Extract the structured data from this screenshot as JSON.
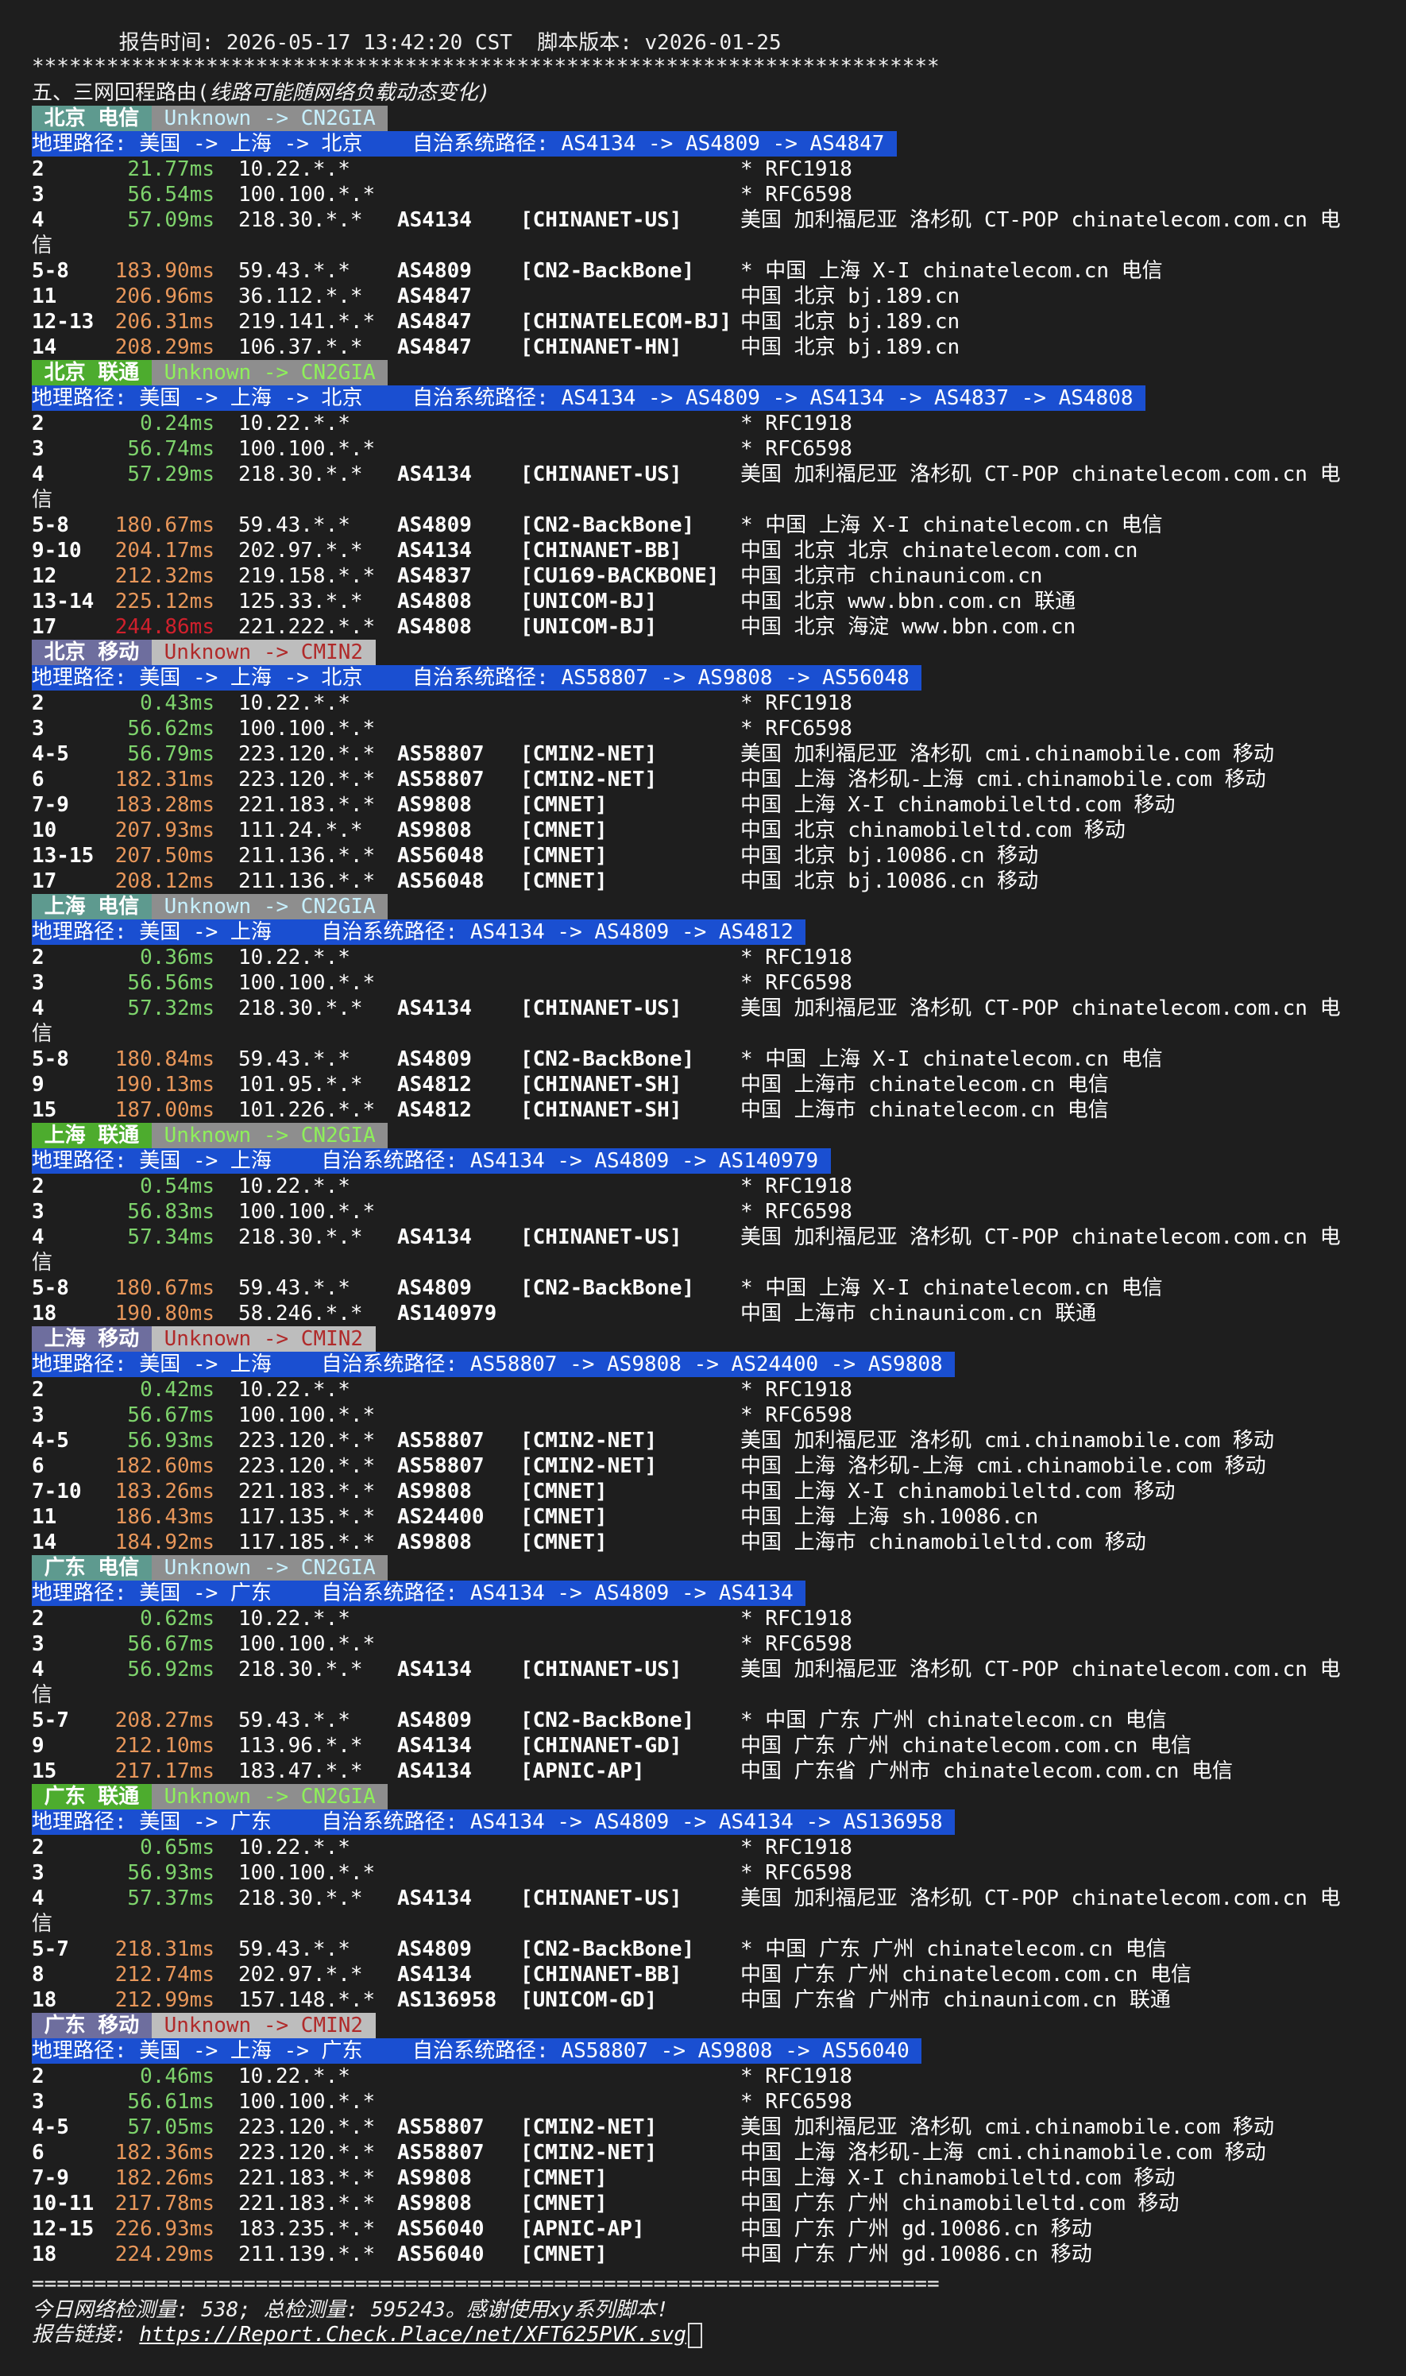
{
  "header": {
    "time_line": "       报告时间: 2026-05-17 13:42:20 CST  脚本版本: v2026-01-25",
    "stars": "*************************************************************************",
    "section_title": "五、三网回程路由(",
    "section_note": "线路可能随网络负载动态变化)"
  },
  "colors": {
    "telecom_tag_bg": "#5e9a8f",
    "unicom_tag_bg": "#4dac2e",
    "mobile_tag_bg": "#6e6e9e",
    "cn2gia_tag_bg": "#8e8e8e",
    "cmin2_tag_bg": "#bdbdbd",
    "geo_bar_bg": "#1a4fd1",
    "latency_green": "#7ed36c",
    "latency_orange": "#e8975a",
    "latency_red": "#d0202c"
  },
  "blocks": [
    {
      "tag": " 北京 电信 ",
      "tag_type": "telecom",
      "route": " Unknown -> CN2GIA ",
      "route_type": "cn2gia",
      "geo": "地理路径: 美国 -> 上海 -> 北京    自治系统路径: AS4134 -> AS4809 -> AS4847 ",
      "hops": [
        {
          "hop": "2",
          "lat": "21.77ms",
          "c": "green",
          "ip": "10.22.*.*",
          "asn": "",
          "net": "",
          "loc": "* RFC1918"
        },
        {
          "hop": "3",
          "lat": "56.54ms",
          "c": "green",
          "ip": "100.100.*.*",
          "asn": "",
          "net": "",
          "loc": "* RFC6598"
        },
        {
          "hop": "4",
          "lat": "57.09ms",
          "c": "green",
          "ip": "218.30.*.*",
          "asn": "AS4134",
          "net": "[CHINANET-US]",
          "loc": "美国 加利福尼亚 洛杉矶 CT-POP chinatelecom.com.cn 电",
          "wrap": "信"
        },
        {
          "hop": "5-8",
          "lat": "183.90ms",
          "c": "orange",
          "ip": "59.43.*.*",
          "asn": "AS4809",
          "net": "[CN2-BackBone]",
          "loc": "* 中国 上海 X-I chinatelecom.cn 电信"
        },
        {
          "hop": "11",
          "lat": "206.96ms",
          "c": "orange",
          "ip": "36.112.*.*",
          "asn": "AS4847",
          "net": "",
          "loc": "中国 北京 bj.189.cn"
        },
        {
          "hop": "12-13",
          "lat": "206.31ms",
          "c": "orange",
          "ip": "219.141.*.*",
          "asn": "AS4847",
          "net": "[CHINATELECOM-BJ]",
          "loc": "中国 北京 bj.189.cn"
        },
        {
          "hop": "14",
          "lat": "208.29ms",
          "c": "orange",
          "ip": "106.37.*.*",
          "asn": "AS4847",
          "net": "[CHINANET-HN]",
          "loc": "中国 北京 bj.189.cn"
        }
      ]
    },
    {
      "tag": " 北京 联通 ",
      "tag_type": "unicom",
      "route": " Unknown -> CN2GIA ",
      "route_type": "cn2gia_green",
      "geo": "地理路径: 美国 -> 上海 -> 北京    自治系统路径: AS4134 -> AS4809 -> AS4134 -> AS4837 -> AS4808 ",
      "hops": [
        {
          "hop": "2",
          "lat": "0.24ms",
          "c": "green",
          "ip": "10.22.*.*",
          "asn": "",
          "net": "",
          "loc": "* RFC1918"
        },
        {
          "hop": "3",
          "lat": "56.74ms",
          "c": "green",
          "ip": "100.100.*.*",
          "asn": "",
          "net": "",
          "loc": "* RFC6598"
        },
        {
          "hop": "4",
          "lat": "57.29ms",
          "c": "green",
          "ip": "218.30.*.*",
          "asn": "AS4134",
          "net": "[CHINANET-US]",
          "loc": "美国 加利福尼亚 洛杉矶 CT-POP chinatelecom.com.cn 电",
          "wrap": "信"
        },
        {
          "hop": "5-8",
          "lat": "180.67ms",
          "c": "orange",
          "ip": "59.43.*.*",
          "asn": "AS4809",
          "net": "[CN2-BackBone]",
          "loc": "* 中国 上海 X-I chinatelecom.cn 电信"
        },
        {
          "hop": "9-10",
          "lat": "204.17ms",
          "c": "orange",
          "ip": "202.97.*.*",
          "asn": "AS4134",
          "net": "[CHINANET-BB]",
          "loc": "中国 北京 北京 chinatelecom.com.cn"
        },
        {
          "hop": "12",
          "lat": "212.32ms",
          "c": "orange",
          "ip": "219.158.*.*",
          "asn": "AS4837",
          "net": "[CU169-BACKBONE]",
          "loc": "中国 北京市 chinaunicom.cn"
        },
        {
          "hop": "13-14",
          "lat": "225.12ms",
          "c": "orange",
          "ip": "125.33.*.*",
          "asn": "AS4808",
          "net": "[UNICOM-BJ]",
          "loc": "中国 北京 www.bbn.com.cn 联通"
        },
        {
          "hop": "17",
          "lat": "244.86ms",
          "c": "red",
          "ip": "221.222.*.*",
          "asn": "AS4808",
          "net": "[UNICOM-BJ]",
          "loc": "中国 北京 海淀 www.bbn.com.cn"
        }
      ]
    },
    {
      "tag": " 北京 移动 ",
      "tag_type": "mobile",
      "route": " Unknown -> CMIN2 ",
      "route_type": "cmin2",
      "geo": "地理路径: 美国 -> 上海 -> 北京    自治系统路径: AS58807 -> AS9808 -> AS56048 ",
      "hops": [
        {
          "hop": "2",
          "lat": "0.43ms",
          "c": "green",
          "ip": "10.22.*.*",
          "asn": "",
          "net": "",
          "loc": "* RFC1918"
        },
        {
          "hop": "3",
          "lat": "56.62ms",
          "c": "green",
          "ip": "100.100.*.*",
          "asn": "",
          "net": "",
          "loc": "* RFC6598"
        },
        {
          "hop": "4-5",
          "lat": "56.79ms",
          "c": "green",
          "ip": "223.120.*.*",
          "asn": "AS58807",
          "net": "[CMIN2-NET]",
          "loc": "美国 加利福尼亚 洛杉矶 cmi.chinamobile.com 移动"
        },
        {
          "hop": "6",
          "lat": "182.31ms",
          "c": "orange",
          "ip": "223.120.*.*",
          "asn": "AS58807",
          "net": "[CMIN2-NET]",
          "loc": "中国 上海 洛杉矶-上海 cmi.chinamobile.com 移动"
        },
        {
          "hop": "7-9",
          "lat": "183.28ms",
          "c": "orange",
          "ip": "221.183.*.*",
          "asn": "AS9808",
          "net": "[CMNET]",
          "loc": "中国 上海 X-I chinamobileltd.com 移动"
        },
        {
          "hop": "10",
          "lat": "207.93ms",
          "c": "orange",
          "ip": "111.24.*.*",
          "asn": "AS9808",
          "net": "[CMNET]",
          "loc": "中国 北京 chinamobileltd.com 移动"
        },
        {
          "hop": "13-15",
          "lat": "207.50ms",
          "c": "orange",
          "ip": "211.136.*.*",
          "asn": "AS56048",
          "net": "[CMNET]",
          "loc": "中国 北京 bj.10086.cn 移动"
        },
        {
          "hop": "17",
          "lat": "208.12ms",
          "c": "orange",
          "ip": "211.136.*.*",
          "asn": "AS56048",
          "net": "[CMNET]",
          "loc": "中国 北京 bj.10086.cn 移动"
        }
      ]
    },
    {
      "tag": " 上海 电信 ",
      "tag_type": "telecom",
      "route": " Unknown -> CN2GIA ",
      "route_type": "cn2gia",
      "geo": "地理路径: 美国 -> 上海    自治系统路径: AS4134 -> AS4809 -> AS4812 ",
      "hops": [
        {
          "hop": "2",
          "lat": "0.36ms",
          "c": "green",
          "ip": "10.22.*.*",
          "asn": "",
          "net": "",
          "loc": "* RFC1918"
        },
        {
          "hop": "3",
          "lat": "56.56ms",
          "c": "green",
          "ip": "100.100.*.*",
          "asn": "",
          "net": "",
          "loc": "* RFC6598"
        },
        {
          "hop": "4",
          "lat": "57.32ms",
          "c": "green",
          "ip": "218.30.*.*",
          "asn": "AS4134",
          "net": "[CHINANET-US]",
          "loc": "美国 加利福尼亚 洛杉矶 CT-POP chinatelecom.com.cn 电",
          "wrap": "信"
        },
        {
          "hop": "5-8",
          "lat": "180.84ms",
          "c": "orange",
          "ip": "59.43.*.*",
          "asn": "AS4809",
          "net": "[CN2-BackBone]",
          "loc": "* 中国 上海 X-I chinatelecom.cn 电信"
        },
        {
          "hop": "9",
          "lat": "190.13ms",
          "c": "orange",
          "ip": "101.95.*.*",
          "asn": "AS4812",
          "net": "[CHINANET-SH]",
          "loc": "中国 上海市 chinatelecom.cn 电信"
        },
        {
          "hop": "15",
          "lat": "187.00ms",
          "c": "orange",
          "ip": "101.226.*.*",
          "asn": "AS4812",
          "net": "[CHINANET-SH]",
          "loc": "中国 上海市 chinatelecom.cn 电信"
        }
      ]
    },
    {
      "tag": " 上海 联通 ",
      "tag_type": "unicom",
      "route": " Unknown -> CN2GIA ",
      "route_type": "cn2gia_green",
      "geo": "地理路径: 美国 -> 上海    自治系统路径: AS4134 -> AS4809 -> AS140979 ",
      "hops": [
        {
          "hop": "2",
          "lat": "0.54ms",
          "c": "green",
          "ip": "10.22.*.*",
          "asn": "",
          "net": "",
          "loc": "* RFC1918"
        },
        {
          "hop": "3",
          "lat": "56.83ms",
          "c": "green",
          "ip": "100.100.*.*",
          "asn": "",
          "net": "",
          "loc": "* RFC6598"
        },
        {
          "hop": "4",
          "lat": "57.34ms",
          "c": "green",
          "ip": "218.30.*.*",
          "asn": "AS4134",
          "net": "[CHINANET-US]",
          "loc": "美国 加利福尼亚 洛杉矶 CT-POP chinatelecom.com.cn 电",
          "wrap": "信"
        },
        {
          "hop": "5-8",
          "lat": "180.67ms",
          "c": "orange",
          "ip": "59.43.*.*",
          "asn": "AS4809",
          "net": "[CN2-BackBone]",
          "loc": "* 中国 上海 X-I chinatelecom.cn 电信"
        },
        {
          "hop": "18",
          "lat": "190.80ms",
          "c": "orange",
          "ip": "58.246.*.*",
          "asn": "AS140979",
          "net": "",
          "loc": "中国 上海市 chinaunicom.cn 联通"
        }
      ]
    },
    {
      "tag": " 上海 移动 ",
      "tag_type": "mobile",
      "route": " Unknown -> CMIN2 ",
      "route_type": "cmin2",
      "geo": "地理路径: 美国 -> 上海    自治系统路径: AS58807 -> AS9808 -> AS24400 -> AS9808 ",
      "hops": [
        {
          "hop": "2",
          "lat": "0.42ms",
          "c": "green",
          "ip": "10.22.*.*",
          "asn": "",
          "net": "",
          "loc": "* RFC1918"
        },
        {
          "hop": "3",
          "lat": "56.67ms",
          "c": "green",
          "ip": "100.100.*.*",
          "asn": "",
          "net": "",
          "loc": "* RFC6598"
        },
        {
          "hop": "4-5",
          "lat": "56.93ms",
          "c": "green",
          "ip": "223.120.*.*",
          "asn": "AS58807",
          "net": "[CMIN2-NET]",
          "loc": "美国 加利福尼亚 洛杉矶 cmi.chinamobile.com 移动"
        },
        {
          "hop": "6",
          "lat": "182.60ms",
          "c": "orange",
          "ip": "223.120.*.*",
          "asn": "AS58807",
          "net": "[CMIN2-NET]",
          "loc": "中国 上海 洛杉矶-上海 cmi.chinamobile.com 移动"
        },
        {
          "hop": "7-10",
          "lat": "183.26ms",
          "c": "orange",
          "ip": "221.183.*.*",
          "asn": "AS9808",
          "net": "[CMNET]",
          "loc": "中国 上海 X-I chinamobileltd.com 移动"
        },
        {
          "hop": "11",
          "lat": "186.43ms",
          "c": "orange",
          "ip": "117.135.*.*",
          "asn": "AS24400",
          "net": "[CMNET]",
          "loc": "中国 上海 上海 sh.10086.cn"
        },
        {
          "hop": "14",
          "lat": "184.92ms",
          "c": "orange",
          "ip": "117.185.*.*",
          "asn": "AS9808",
          "net": "[CMNET]",
          "loc": "中国 上海市 chinamobileltd.com 移动"
        }
      ]
    },
    {
      "tag": " 广东 电信 ",
      "tag_type": "telecom",
      "route": " Unknown -> CN2GIA ",
      "route_type": "cn2gia",
      "geo": "地理路径: 美国 -> 广东    自治系统路径: AS4134 -> AS4809 -> AS4134 ",
      "hops": [
        {
          "hop": "2",
          "lat": "0.62ms",
          "c": "green",
          "ip": "10.22.*.*",
          "asn": "",
          "net": "",
          "loc": "* RFC1918"
        },
        {
          "hop": "3",
          "lat": "56.67ms",
          "c": "green",
          "ip": "100.100.*.*",
          "asn": "",
          "net": "",
          "loc": "* RFC6598"
        },
        {
          "hop": "4",
          "lat": "56.92ms",
          "c": "green",
          "ip": "218.30.*.*",
          "asn": "AS4134",
          "net": "[CHINANET-US]",
          "loc": "美国 加利福尼亚 洛杉矶 CT-POP chinatelecom.com.cn 电",
          "wrap": "信"
        },
        {
          "hop": "5-7",
          "lat": "208.27ms",
          "c": "orange",
          "ip": "59.43.*.*",
          "asn": "AS4809",
          "net": "[CN2-BackBone]",
          "loc": "* 中国 广东 广州 chinatelecom.cn 电信"
        },
        {
          "hop": "9",
          "lat": "212.10ms",
          "c": "orange",
          "ip": "113.96.*.*",
          "asn": "AS4134",
          "net": "[CHINANET-GD]",
          "loc": "中国 广东 广州 chinatelecom.com.cn 电信"
        },
        {
          "hop": "15",
          "lat": "217.17ms",
          "c": "orange",
          "ip": "183.47.*.*",
          "asn": "AS4134",
          "net": "[APNIC-AP]",
          "loc": "中国 广东省 广州市 chinatelecom.com.cn 电信"
        }
      ]
    },
    {
      "tag": " 广东 联通 ",
      "tag_type": "unicom",
      "route": " Unknown -> CN2GIA ",
      "route_type": "cn2gia_green",
      "geo": "地理路径: 美国 -> 广东    自治系统路径: AS4134 -> AS4809 -> AS4134 -> AS136958 ",
      "hops": [
        {
          "hop": "2",
          "lat": "0.65ms",
          "c": "green",
          "ip": "10.22.*.*",
          "asn": "",
          "net": "",
          "loc": "* RFC1918"
        },
        {
          "hop": "3",
          "lat": "56.93ms",
          "c": "green",
          "ip": "100.100.*.*",
          "asn": "",
          "net": "",
          "loc": "* RFC6598"
        },
        {
          "hop": "4",
          "lat": "57.37ms",
          "c": "green",
          "ip": "218.30.*.*",
          "asn": "AS4134",
          "net": "[CHINANET-US]",
          "loc": "美国 加利福尼亚 洛杉矶 CT-POP chinatelecom.com.cn 电",
          "wrap": "信"
        },
        {
          "hop": "5-7",
          "lat": "218.31ms",
          "c": "orange",
          "ip": "59.43.*.*",
          "asn": "AS4809",
          "net": "[CN2-BackBone]",
          "loc": "* 中国 广东 广州 chinatelecom.cn 电信"
        },
        {
          "hop": "8",
          "lat": "212.74ms",
          "c": "orange",
          "ip": "202.97.*.*",
          "asn": "AS4134",
          "net": "[CHINANET-BB]",
          "loc": "中国 广东 广州 chinatelecom.com.cn 电信"
        },
        {
          "hop": "18",
          "lat": "212.99ms",
          "c": "orange",
          "ip": "157.148.*.*",
          "asn": "AS136958",
          "net": "[UNICOM-GD]",
          "loc": "中国 广东省 广州市 chinaunicom.cn 联通"
        }
      ]
    },
    {
      "tag": " 广东 移动 ",
      "tag_type": "mobile",
      "route": " Unknown -> CMIN2 ",
      "route_type": "cmin2",
      "geo": "地理路径: 美国 -> 上海 -> 广东    自治系统路径: AS58807 -> AS9808 -> AS56040 ",
      "hops": [
        {
          "hop": "2",
          "lat": "0.46ms",
          "c": "green",
          "ip": "10.22.*.*",
          "asn": "",
          "net": "",
          "loc": "* RFC1918"
        },
        {
          "hop": "3",
          "lat": "56.61ms",
          "c": "green",
          "ip": "100.100.*.*",
          "asn": "",
          "net": "",
          "loc": "* RFC6598"
        },
        {
          "hop": "4-5",
          "lat": "57.05ms",
          "c": "green",
          "ip": "223.120.*.*",
          "asn": "AS58807",
          "net": "[CMIN2-NET]",
          "loc": "美国 加利福尼亚 洛杉矶 cmi.chinamobile.com 移动"
        },
        {
          "hop": "6",
          "lat": "182.36ms",
          "c": "orange",
          "ip": "223.120.*.*",
          "asn": "AS58807",
          "net": "[CMIN2-NET]",
          "loc": "中国 上海 洛杉矶-上海 cmi.chinamobile.com 移动"
        },
        {
          "hop": "7-9",
          "lat": "182.26ms",
          "c": "orange",
          "ip": "221.183.*.*",
          "asn": "AS9808",
          "net": "[CMNET]",
          "loc": "中国 上海 X-I chinamobileltd.com 移动"
        },
        {
          "hop": "10-11",
          "lat": "217.78ms",
          "c": "orange",
          "ip": "221.183.*.*",
          "asn": "AS9808",
          "net": "[CMNET]",
          "loc": "中国 广东 广州 chinamobileltd.com 移动"
        },
        {
          "hop": "12-15",
          "lat": "226.93ms",
          "c": "orange",
          "ip": "183.235.*.*",
          "asn": "AS56040",
          "net": "[APNIC-AP]",
          "loc": "中国 广东 广州 gd.10086.cn 移动"
        },
        {
          "hop": "18",
          "lat": "224.29ms",
          "c": "orange",
          "ip": "211.139.*.*",
          "asn": "AS56040",
          "net": "[CMNET]",
          "loc": "中国 广东 广州 gd.10086.cn 移动"
        }
      ]
    }
  ],
  "footer": {
    "equals": "=========================================================================",
    "stats": "今日网络检测量: 538; 总检测量: 595243。感谢使用xy系列脚本!",
    "link_label": "报告链接: ",
    "link_url": "https://Report.Check.Place/net/XFT625PVK.svg"
  }
}
